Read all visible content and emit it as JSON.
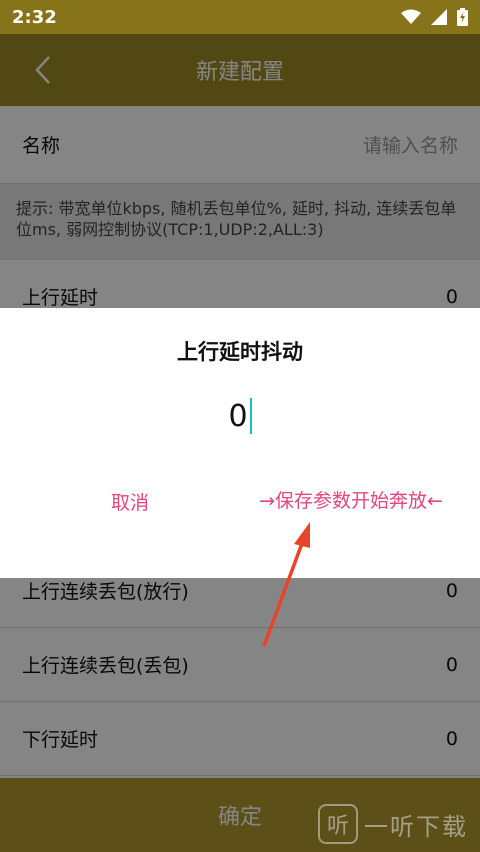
{
  "status_bar": {
    "time": "2:32"
  },
  "app_bar": {
    "title": "新建配置"
  },
  "form": {
    "name_label": "名称",
    "name_placeholder": "请输入名称",
    "hint": "提示: 带宽单位kbps, 随机丢包单位%, 延时, 抖动, 连续丢包单位ms, 弱网控制协议(TCP:1,UDP:2,ALL:3)",
    "rows": [
      {
        "label": "上行延时",
        "value": "0"
      },
      {
        "label": "上行连续丢包(放行)",
        "value": "0"
      },
      {
        "label": "上行连续丢包(丢包)",
        "value": "0"
      },
      {
        "label": "下行延时",
        "value": "0"
      }
    ]
  },
  "confirm_label": "确定",
  "dialog": {
    "title": "上行延时抖动",
    "input_value": "0",
    "cancel_label": "取消",
    "save_label": "→保存参数开始奔放←"
  },
  "watermark": {
    "text": "一听下载",
    "badge": "听"
  },
  "colors": {
    "app_bar": "#9e8a27",
    "accent": "#e8447e",
    "caret": "#19c2b5",
    "annotation_arrow": "#e8442a"
  }
}
